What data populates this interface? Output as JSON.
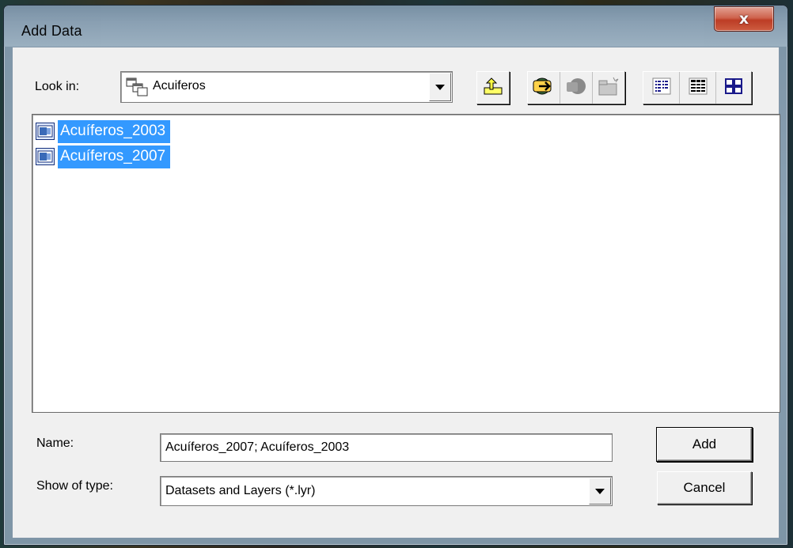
{
  "window": {
    "title": "Add Data",
    "close_glyph": "x"
  },
  "look_in": {
    "label": "Look in:",
    "value": "Acuiferos",
    "icon": "folder-tree-icon"
  },
  "toolbar": {
    "buttons": [
      {
        "name": "up-one-level",
        "icon": "up-folder-icon"
      },
      {
        "name": "connect-to-folder",
        "icon": "connect-folder-icon"
      },
      {
        "name": "disconnect-folder",
        "icon": "disconnect-folder-icon"
      },
      {
        "name": "new-folder",
        "icon": "new-folder-icon"
      },
      {
        "name": "list-view",
        "icon": "list-view-icon"
      },
      {
        "name": "details-view",
        "icon": "details-view-icon"
      },
      {
        "name": "thumbnails-view",
        "icon": "thumbnails-view-icon"
      }
    ]
  },
  "files": [
    {
      "name": "Acuíferos_2003",
      "icon": "map-layer-icon",
      "selected": true
    },
    {
      "name": "Acuíferos_2007",
      "icon": "map-layer-icon",
      "selected": true
    }
  ],
  "name_field": {
    "label": "Name:",
    "value": "Acuíferos_2007; Acuíferos_2003"
  },
  "type_field": {
    "label": "Show of type:",
    "value": "Datasets and Layers (*.lyr)"
  },
  "buttons": {
    "add": "Add",
    "cancel": "Cancel"
  },
  "colors": {
    "selection": "#3399ff",
    "dialog_bg": "#f0f0f0",
    "close_button": "#c1391f"
  }
}
